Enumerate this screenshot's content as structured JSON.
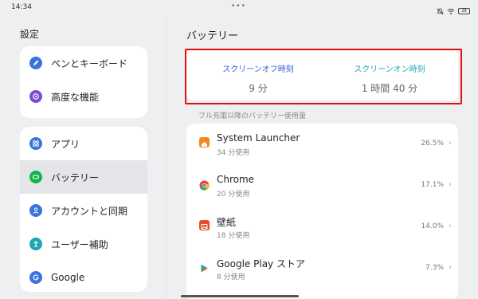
{
  "status": {
    "time": "14:34",
    "dots": "•••",
    "battery": "28"
  },
  "sidebar": {
    "title": "設定",
    "group1": [
      {
        "label": "ペンとキーボード",
        "icon": "pen-icon"
      },
      {
        "label": "高度な機能",
        "icon": "advanced-features-icon"
      }
    ],
    "group2": [
      {
        "label": "アプリ",
        "icon": "apps-grid-icon"
      },
      {
        "label": "バッテリー",
        "icon": "battery-icon",
        "selected": true
      },
      {
        "label": "アカウントと同期",
        "icon": "account-icon"
      },
      {
        "label": "ユーザー補助",
        "icon": "accessibility-icon"
      },
      {
        "label": "Google",
        "icon": "google-icon"
      }
    ]
  },
  "main": {
    "title": "バッテリー",
    "screen_off": {
      "label": "スクリーンオフ時刻",
      "value": "9 分"
    },
    "screen_on": {
      "label": "スクリーンオン時刻",
      "value": "1 時間 40 分"
    },
    "usage_header": "フル充電以降のバッテリー使用量",
    "apps": [
      {
        "name": "System Launcher",
        "usage": "34 分使用",
        "percent": "26.5%",
        "icon": "system-launcher-icon",
        "color": "#f08a1c"
      },
      {
        "name": "Chrome",
        "usage": "20 分使用",
        "percent": "17.1%",
        "icon": "chrome-icon",
        "color": "#4285f4"
      },
      {
        "name": "壁紙",
        "usage": "18 分使用",
        "percent": "14.0%",
        "icon": "wallpaper-icon",
        "color": "#ea4b2a"
      },
      {
        "name": "Google Play ストア",
        "usage": "8 分使用",
        "percent": "7.3%",
        "icon": "google-play-icon",
        "color": "#34a853"
      }
    ]
  },
  "colors": {
    "accent_blue": "#3b5bd8",
    "accent_teal": "#24a7b5",
    "highlight_red": "#e01010"
  }
}
